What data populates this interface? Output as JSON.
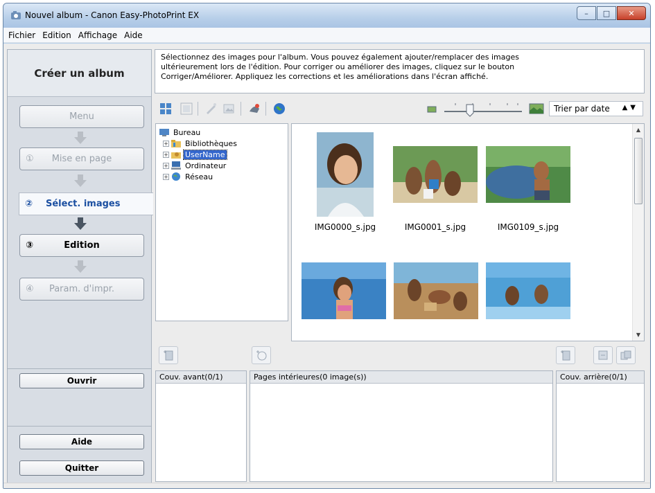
{
  "window": {
    "title": "Nouvel album - Canon Easy-PhotoPrint EX",
    "controls": {
      "minimize": "–",
      "maximize": "□",
      "close": "✕"
    }
  },
  "menubar": [
    "Fichier",
    "Edition",
    "Affichage",
    "Aide"
  ],
  "sidebar": {
    "header": "Créer un album",
    "steps": [
      {
        "num": "",
        "label": "Menu",
        "state": "disabled"
      },
      {
        "num": "①",
        "label": "Mise en page",
        "state": "disabled"
      },
      {
        "num": "②",
        "label": "Sélect. images",
        "state": "active"
      },
      {
        "num": "③",
        "label": "Edition",
        "state": "enabled"
      },
      {
        "num": "④",
        "label": "Param. d'impr.",
        "state": "disabled"
      }
    ],
    "open_label": "Ouvrir",
    "help_label": "Aide",
    "quit_label": "Quitter"
  },
  "instructions": [
    "Sélectionnez des images pour l'album. Vous pouvez également ajouter/remplacer des images",
    "ultérieurement lors de l'édition. Pour corriger ou améliorer des images, cliquez sur le bouton",
    "Corriger/Améliorer. Appliquez les corrections et les améliorations dans l'écran affiché."
  ],
  "toolbar": {
    "icons": [
      "grid-view-icon",
      "select-all-icon",
      "correct-enhance-icon",
      "edit-image-icon",
      "special-filters-icon",
      "web-icon"
    ],
    "zoom_level": 0.35,
    "sort_label": "Trier par date"
  },
  "tree": {
    "root": "Bureau",
    "children": [
      "Bibliothèques",
      "UserName",
      "Ordinateur",
      "Réseau"
    ],
    "selected": "UserName"
  },
  "thumbnails": [
    {
      "filename": "IMG0000_s.jpg",
      "icon": "photo-girl-portrait-icon"
    },
    {
      "filename": "IMG0001_s.jpg",
      "icon": "photo-family-beach-icon"
    },
    {
      "filename": "IMG0109_s.jpg",
      "icon": "photo-boy-surfboard-icon"
    },
    {
      "filename": "",
      "icon": "photo-girl-pool-icon"
    },
    {
      "filename": "",
      "icon": "photo-sand-castle-icon"
    },
    {
      "filename": "",
      "icon": "photo-children-sea-icon"
    }
  ],
  "panels": {
    "front_cover": "Couv. avant(0/1)",
    "inner_pages": "Pages intérieures(0 image(s))",
    "back_cover": "Couv. arrière(0/1)"
  },
  "colors": {
    "active_step": "#1b4fa1",
    "selection": "#3366cc"
  }
}
